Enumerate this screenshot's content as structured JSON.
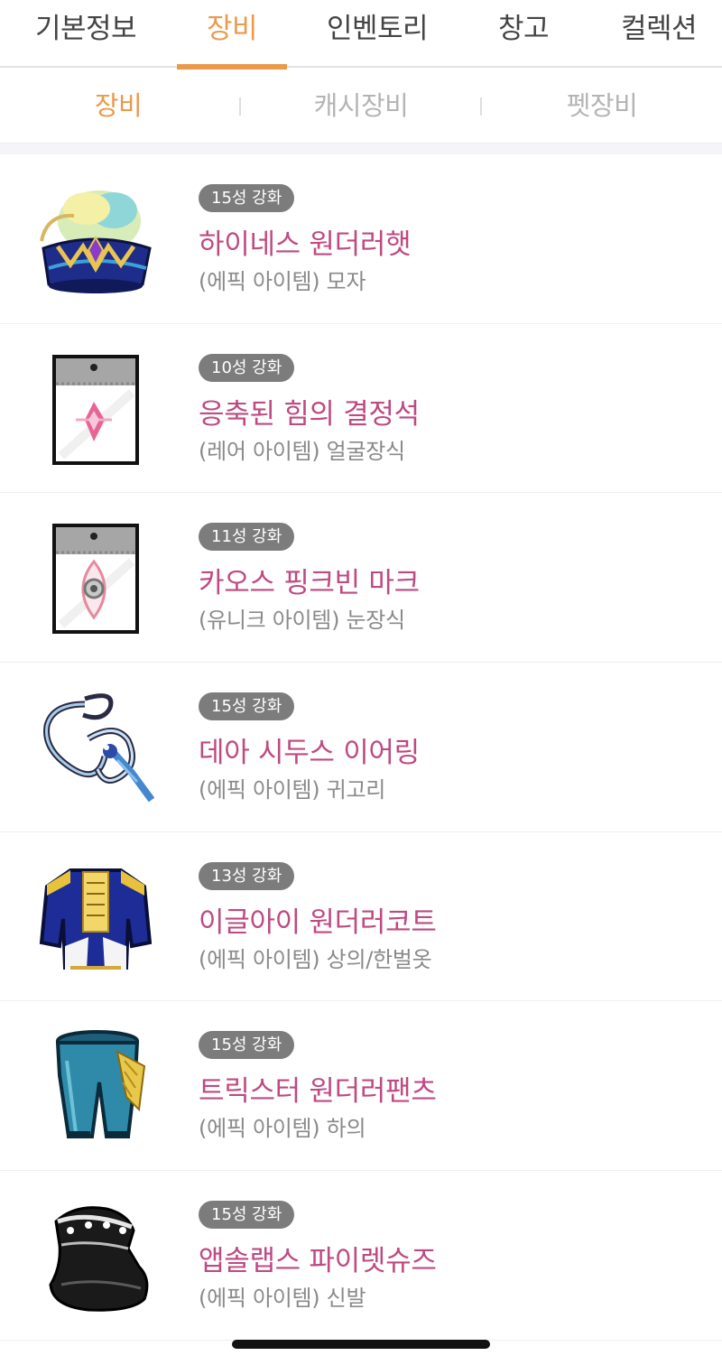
{
  "main_tabs": [
    {
      "label": "기본정보",
      "active": false
    },
    {
      "label": "장비",
      "active": true
    },
    {
      "label": "인벤토리",
      "active": false
    },
    {
      "label": "창고",
      "active": false
    },
    {
      "label": "컬렉션",
      "active": false
    }
  ],
  "sub_tabs": [
    {
      "label": "장비",
      "active": true
    },
    {
      "label": "캐시장비",
      "active": false
    },
    {
      "label": "펫장비",
      "active": false
    }
  ],
  "items": [
    {
      "stars": "15성 강화",
      "name": "하이네스 원더러햇",
      "meta": "(에픽 아이템) 모자",
      "icon": "wanderer-hat-icon"
    },
    {
      "stars": "10성 강화",
      "name": "응축된 힘의 결정석",
      "meta": "(레어 아이템) 얼굴장식",
      "icon": "crystal-card-icon"
    },
    {
      "stars": "11성 강화",
      "name": "카오스 핑크빈 마크",
      "meta": "(유니크 아이템) 눈장식",
      "icon": "pinkbean-mark-icon"
    },
    {
      "stars": "15성 강화",
      "name": "데아 시두스 이어링",
      "meta": "(에픽 아이템) 귀고리",
      "icon": "earring-icon"
    },
    {
      "stars": "13성 강화",
      "name": "이글아이 원더러코트",
      "meta": "(에픽 아이템) 상의/한벌옷",
      "icon": "coat-icon"
    },
    {
      "stars": "15성 강화",
      "name": "트릭스터 원더러팬츠",
      "meta": "(에픽 아이템) 하의",
      "icon": "pants-icon"
    },
    {
      "stars": "15성 강화",
      "name": "앱솔랩스 파이렛슈즈",
      "meta": "(에픽 아이템) 신발",
      "icon": "shoes-icon"
    }
  ],
  "colors": {
    "accent": "#eb9a4b",
    "item_name": "#be4a82",
    "badge_bg": "#7c7c7c",
    "meta_text": "#8a8a8a"
  }
}
